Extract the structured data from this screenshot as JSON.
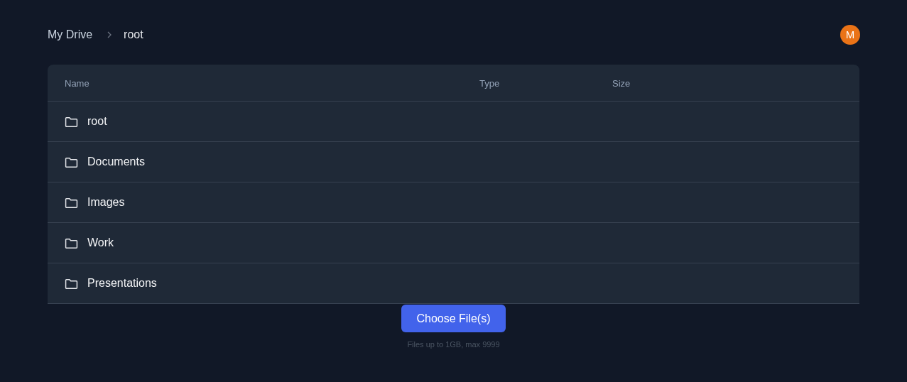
{
  "breadcrumb": [
    "My Drive",
    "root"
  ],
  "avatar": {
    "initial": "M"
  },
  "table": {
    "columns": [
      "Name",
      "Type",
      "Size"
    ],
    "rows": [
      {
        "kind": "folder",
        "name": "root"
      },
      {
        "kind": "folder",
        "name": "Documents"
      },
      {
        "kind": "folder",
        "name": "Images"
      },
      {
        "kind": "folder",
        "name": "Work"
      },
      {
        "kind": "folder",
        "name": "Presentations"
      }
    ]
  },
  "upload": {
    "button": "Choose File(s)",
    "hint": "Files up to 1GB, max 9999"
  }
}
